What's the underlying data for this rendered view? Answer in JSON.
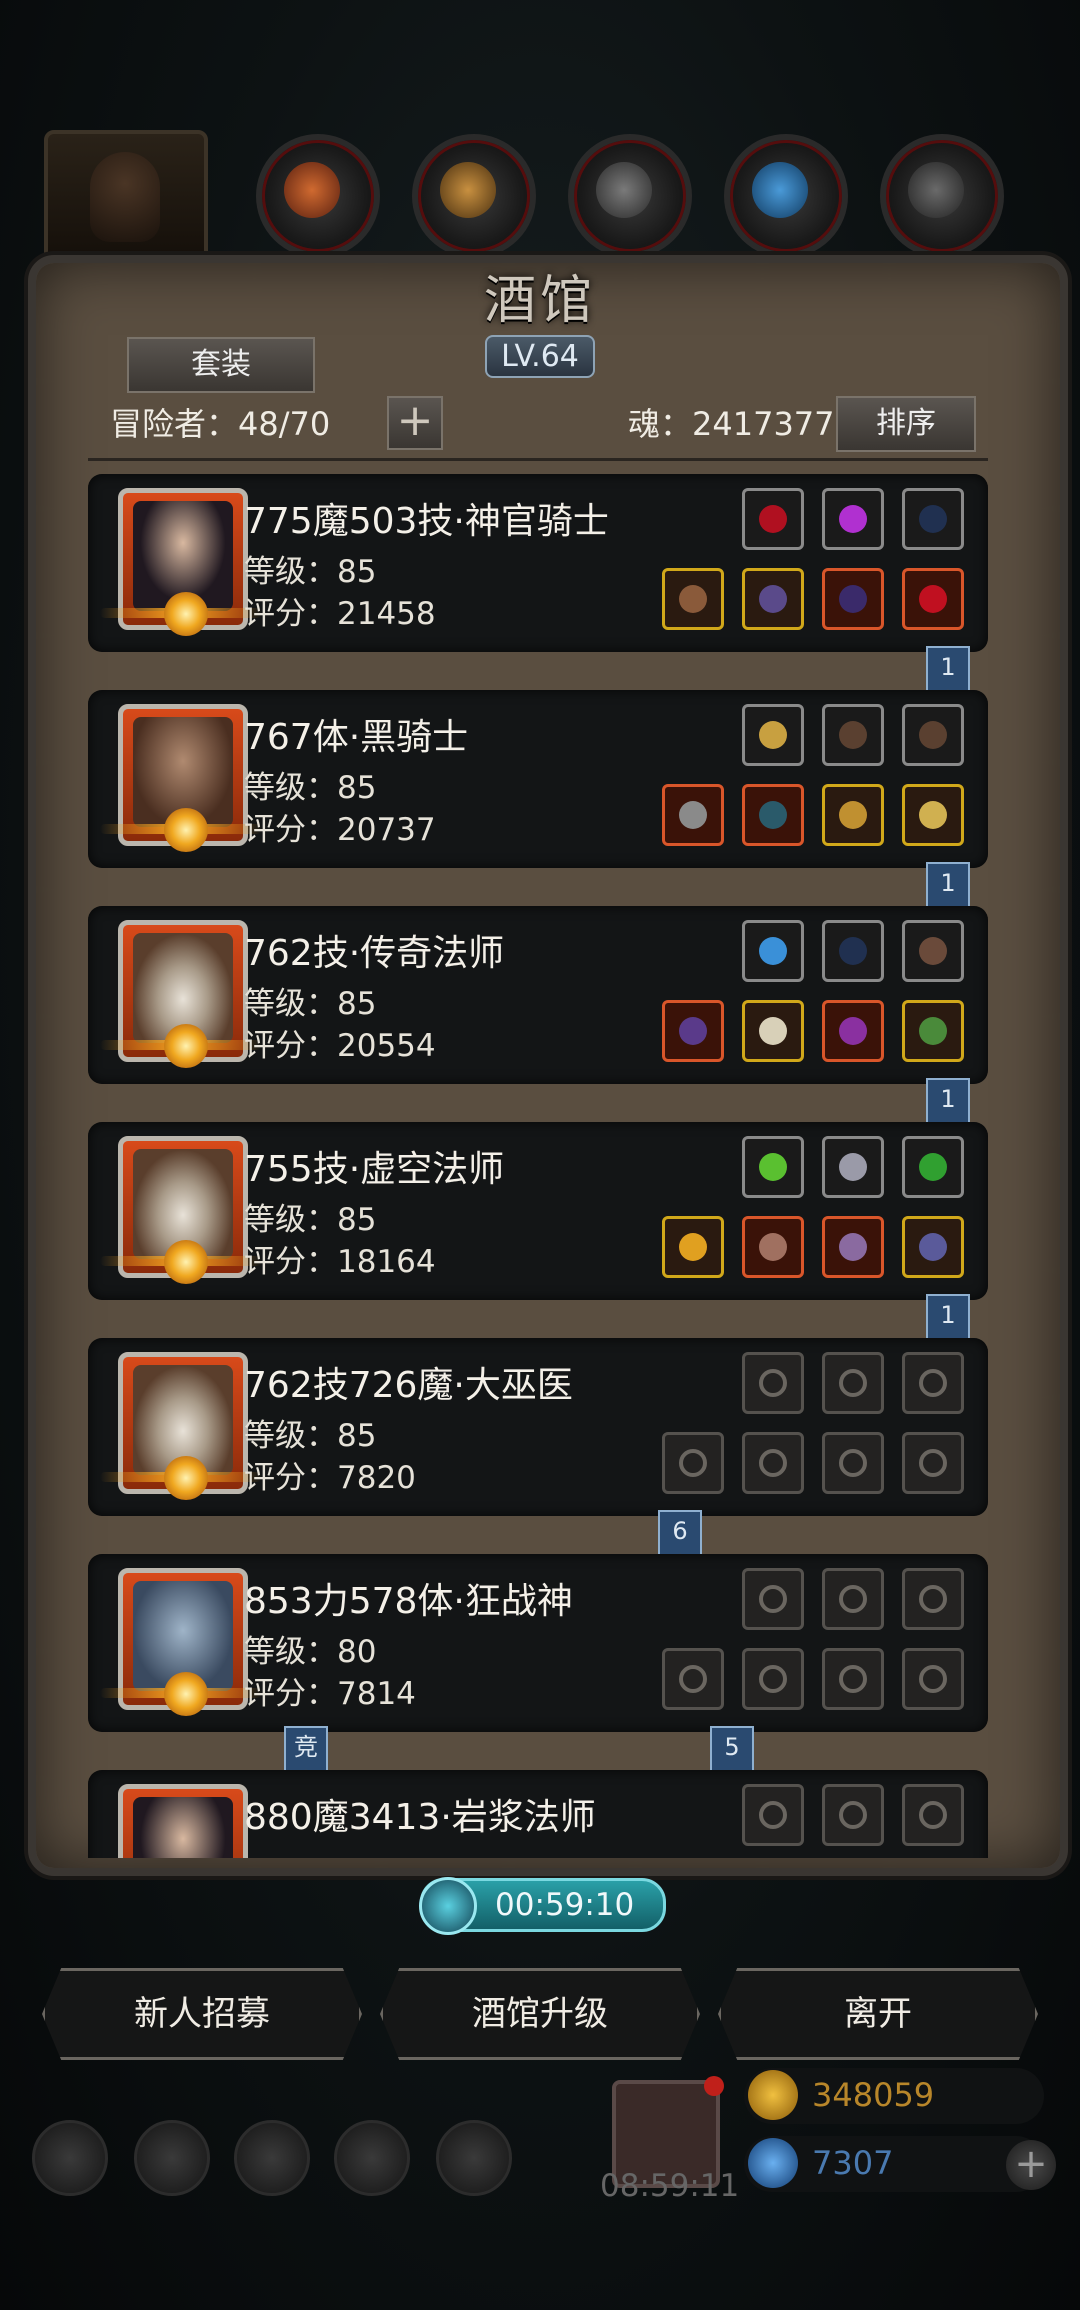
{
  "tavern": {
    "title": "酒馆",
    "level": "LV.64",
    "set_label": "套装",
    "adventurers_label": "冒险者：48/70",
    "soul_label": "魂：2417377",
    "sort_label": "排序"
  },
  "heroes": [
    {
      "name": "775魔503技·神官骑士",
      "level": "等级：85",
      "score": "评分：21458",
      "portrait": "female-priest",
      "bookmark": "1"
    },
    {
      "name": "767体·黑骑士",
      "level": "等级：85",
      "score": "评分：20737",
      "portrait": "dark-knight",
      "bookmark": "1"
    },
    {
      "name": "762技·传奇法师",
      "level": "等级：85",
      "score": "评分：20554",
      "portrait": "bearded-mage",
      "bookmark": "1"
    },
    {
      "name": "755技·虚空法师",
      "level": "等级：85",
      "score": "评分：18164",
      "portrait": "bearded-mage",
      "bookmark": "1"
    },
    {
      "name": "762技726魔·大巫医",
      "level": "等级：85",
      "score": "评分：7820",
      "portrait": "bearded-mage",
      "bookmark": "6"
    },
    {
      "name": "853力578体·狂战神",
      "level": "等级：80",
      "score": "评分：7814",
      "portrait": "blue-berserker",
      "bookmark": "5",
      "badge": "竞"
    },
    {
      "name": "880魔3413·岩浆法师",
      "level": "",
      "score": "",
      "portrait": "hooded-mage"
    }
  ],
  "timer": "00:59:10",
  "actions": {
    "recruit": "新人招募",
    "upgrade": "酒馆升级",
    "leave": "离开"
  },
  "footer": {
    "gift_time": "08:59:11",
    "gold": "348059",
    "gems": "7307"
  },
  "colors": {
    "gold_border": "#d1a81a",
    "red_border": "#d9562a",
    "gray_border": "#8a8a8a",
    "bookmark": "#2a4a70"
  }
}
